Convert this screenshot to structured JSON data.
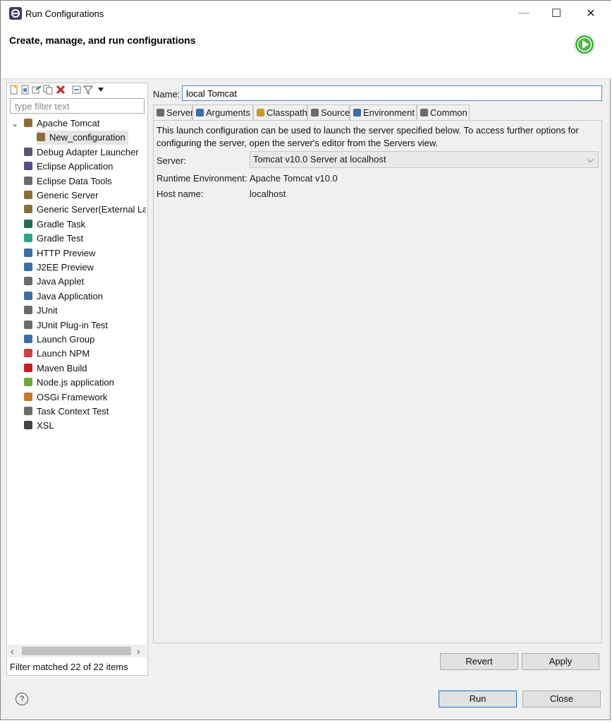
{
  "window": {
    "title": "Run Configurations",
    "header_title": "Create, manage, and run configurations",
    "minimize_glyph": "—",
    "maximize_glyph": "☐",
    "close_glyph": "✕"
  },
  "left": {
    "filter_placeholder": "type filter text",
    "expand_glyph": "⌄",
    "tree": [
      {
        "label": "Apache Tomcat",
        "icon": "tomcat-icon",
        "level": 0,
        "expanded": true
      },
      {
        "label": "New_configuration",
        "icon": "tomcat-config-icon",
        "level": 1,
        "selected": true
      },
      {
        "label": "Debug Adapter Launcher",
        "icon": "debug-adapter-icon",
        "level": 0
      },
      {
        "label": "Eclipse Application",
        "icon": "eclipse-app-icon",
        "level": 0
      },
      {
        "label": "Eclipse Data Tools",
        "icon": "data-tools-icon",
        "level": 0
      },
      {
        "label": "Generic Server",
        "icon": "generic-server-icon",
        "level": 0
      },
      {
        "label": "Generic Server(External Laun",
        "icon": "generic-server-external-icon",
        "level": 0
      },
      {
        "label": "Gradle Task",
        "icon": "gradle-icon",
        "level": 0
      },
      {
        "label": "Gradle Test",
        "icon": "gradle-test-icon",
        "level": 0
      },
      {
        "label": "HTTP Preview",
        "icon": "http-preview-icon",
        "level": 0
      },
      {
        "label": "J2EE Preview",
        "icon": "j2ee-preview-icon",
        "level": 0
      },
      {
        "label": "Java Applet",
        "icon": "java-applet-icon",
        "level": 0
      },
      {
        "label": "Java Application",
        "icon": "java-application-icon",
        "level": 0
      },
      {
        "label": "JUnit",
        "icon": "junit-icon",
        "level": 0
      },
      {
        "label": "JUnit Plug-in Test",
        "icon": "junit-plugin-icon",
        "level": 0
      },
      {
        "label": "Launch Group",
        "icon": "launch-group-icon",
        "level": 0
      },
      {
        "label": "Launch NPM",
        "icon": "npm-icon",
        "level": 0
      },
      {
        "label": "Maven Build",
        "icon": "maven-icon",
        "level": 0
      },
      {
        "label": "Node.js application",
        "icon": "nodejs-icon",
        "level": 0
      },
      {
        "label": "OSGi Framework",
        "icon": "osgi-icon",
        "level": 0
      },
      {
        "label": "Task Context Test",
        "icon": "task-context-icon",
        "level": 0
      },
      {
        "label": "XSL",
        "icon": "xsl-icon",
        "level": 0
      }
    ],
    "scroll_left_glyph": "‹",
    "scroll_right_glyph": "›",
    "status": "Filter matched 22 of 22 items"
  },
  "right": {
    "name_label": "Name:",
    "name_value": "local Tomcat",
    "tabs": [
      {
        "label": "Server",
        "icon": "server-icon",
        "active": true
      },
      {
        "label": "Arguments",
        "icon": "arguments-icon"
      },
      {
        "label": "Classpath",
        "icon": "classpath-icon"
      },
      {
        "label": "Source",
        "icon": "source-icon"
      },
      {
        "label": "Environment",
        "icon": "environment-icon"
      },
      {
        "label": "Common",
        "icon": "common-icon"
      }
    ],
    "description": "This launch configuration can be used to launch the server specified below. To access further options for configuring the server, open the server's editor from the Servers view.",
    "server_label": "Server:",
    "server_value": "Tomcat v10.0 Server at localhost",
    "runtime_label": "Runtime Environment:",
    "runtime_value": "Apache Tomcat v10.0",
    "host_label": "Host name:",
    "host_value": "localhost",
    "select_chevron": "⌵",
    "revert_label": "Revert",
    "apply_label": "Apply"
  },
  "footer": {
    "help_glyph": "?",
    "run_label": "Run",
    "close_label": "Close"
  },
  "colors": {
    "accent": "#1a74d0",
    "run_green": "#3daa3a",
    "selection": "#e5e5e5"
  }
}
